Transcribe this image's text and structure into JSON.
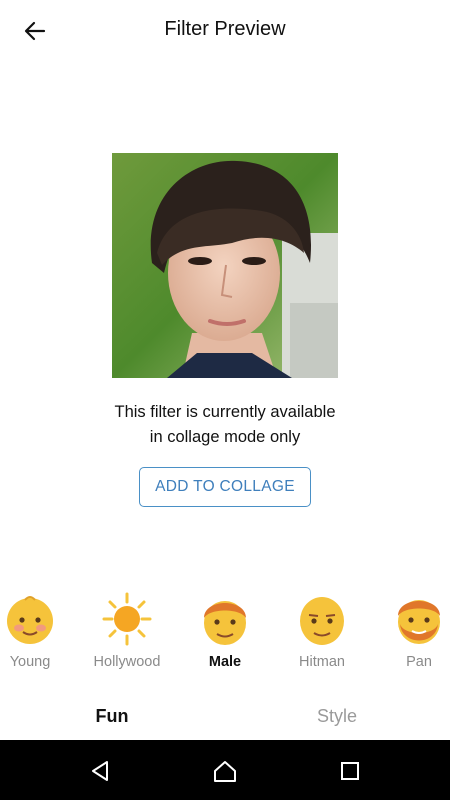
{
  "header": {
    "title": "Filter Preview",
    "back_icon": "arrow-left-icon"
  },
  "preview": {
    "icon": "face-photo"
  },
  "message": {
    "line1": "This filter is currently available",
    "line2": "in collage mode only"
  },
  "actions": {
    "add_to_collage_label": "ADD TO COLLAGE"
  },
  "filters": {
    "selected": "Male",
    "items": [
      {
        "label": "Young",
        "icon": "baby-face-icon"
      },
      {
        "label": "Hollywood",
        "icon": "sun-icon"
      },
      {
        "label": "Male",
        "icon": "male-face-icon"
      },
      {
        "label": "Hitman",
        "icon": "bald-face-icon"
      },
      {
        "label": "Pan",
        "icon": "bearded-face-icon"
      }
    ]
  },
  "tabs": {
    "items": [
      {
        "label": "Fun",
        "active": true
      },
      {
        "label": "Style",
        "active": false
      }
    ]
  },
  "navbar": {
    "back_icon": "nav-back-icon",
    "home_icon": "nav-home-icon",
    "recents_icon": "nav-recents-icon"
  },
  "colors": {
    "accent": "#3f7fbc",
    "emoji_yellow": "#f5c33b",
    "hair_orange": "#e0772a"
  }
}
